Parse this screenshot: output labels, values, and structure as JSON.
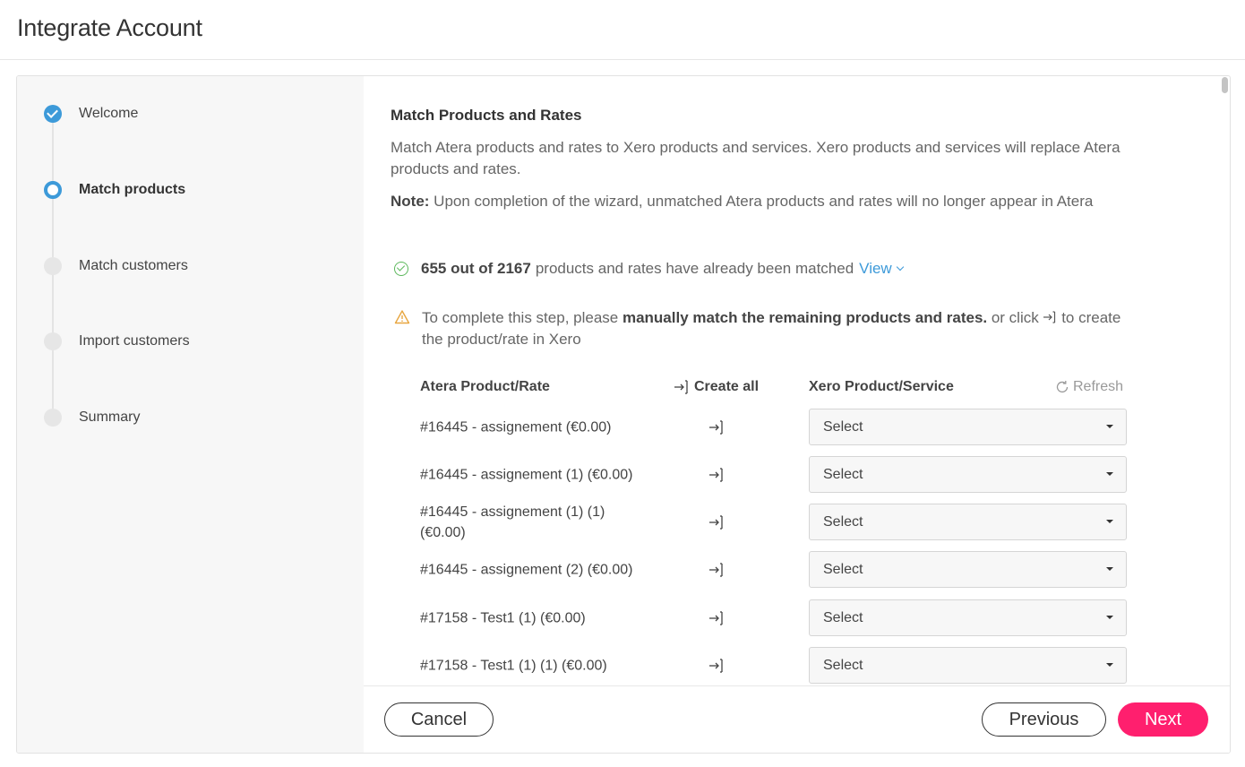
{
  "page": {
    "title": "Integrate Account"
  },
  "steps": [
    {
      "label": "Welcome",
      "state": "done"
    },
    {
      "label": "Match products",
      "state": "active"
    },
    {
      "label": "Match customers",
      "state": "pending"
    },
    {
      "label": "Import customers",
      "state": "pending"
    },
    {
      "label": "Summary",
      "state": "pending"
    }
  ],
  "content": {
    "title": "Match Products and Rates",
    "description": "Match Atera products and rates to Xero products and services. Xero products and services will replace Atera products and rates.",
    "note_label": "Note:",
    "note_text": " Upon completion of the wizard, unmatched Atera products and rates will no longer appear in Atera",
    "matched_count": "655 out of 2167",
    "matched_text": "products and rates have already been matched",
    "view_label": "View",
    "warn_prefix": "To complete this step, please ",
    "warn_bold": "manually match the remaining products and rates.",
    "warn_middle": " or click ",
    "warn_suffix": " to create the product/rate in Xero"
  },
  "table": {
    "col_atera": "Atera Product/Rate",
    "col_create": "Create all",
    "col_xero": "Xero Product/Service",
    "refresh_label": "Refresh",
    "rows": [
      {
        "name": "#16445 - assignement (€0.00)",
        "selected": "Select"
      },
      {
        "name": "#16445 - assignement (1) (€0.00)",
        "selected": "Select"
      },
      {
        "name": "#16445 - assignement (1) (1) (€0.00)",
        "selected": "Select"
      },
      {
        "name": "#16445 - assignement (2) (€0.00)",
        "selected": "Select"
      },
      {
        "name": "#17158 - Test1 (1) (€0.00)",
        "selected": "Select"
      },
      {
        "name": "#17158 - Test1 (1) (1) (€0.00)",
        "selected": "Select"
      }
    ]
  },
  "footer": {
    "cancel_label": "Cancel",
    "previous_label": "Previous",
    "next_label": "Next"
  },
  "colors": {
    "accent_blue": "#3d9ad9",
    "next_pink": "#ff1f6e",
    "success_green": "#5cb85c",
    "warning_orange": "#e8a640"
  }
}
